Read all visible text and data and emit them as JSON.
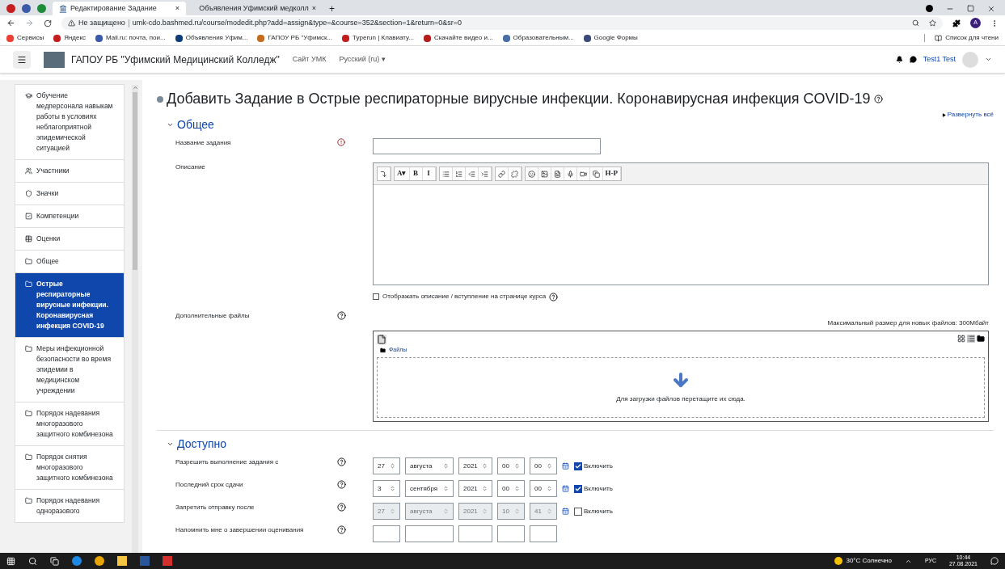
{
  "browser": {
    "tabs": [
      {
        "title": "Редактирование Задание",
        "selected": true,
        "close": "×"
      },
      {
        "title": "Объявления Уфимский медколл",
        "selected": false,
        "close": "×"
      }
    ],
    "new_tab": "+",
    "security": "Не защищено",
    "url": "umk-cdo.bashmed.ru/course/modedit.php?add=assign&type=&course=352&section=1&return=0&sr=0",
    "bookmarks": [
      "Сервисы",
      "Яндекс",
      "Mail.ru: почта, пои...",
      "Объявления Уфим...",
      "ГАПОУ РБ \"Уфимск...",
      "Typerun | Клавиату...",
      "Скачайте видео и...",
      "Образовательным...",
      "Google Формы"
    ],
    "reading_list": "Список для чтени",
    "profile": "A"
  },
  "header": {
    "site": "ГАПОУ РБ \"Уфимский Медицинский Колледж\"",
    "links": [
      "Сайт УМК",
      "Русский (ru) ▾"
    ],
    "user": "Test1 Test"
  },
  "sidebar": {
    "items": [
      {
        "kind": "cap",
        "label": "Обучение медперсонала навыкам работы в условиях неблагоприятной эпидемической ситуацией",
        "selected": false
      },
      {
        "kind": "users",
        "label": "Участники",
        "selected": false
      },
      {
        "kind": "shield",
        "label": "Значки",
        "selected": false
      },
      {
        "kind": "check",
        "label": "Компетенции",
        "selected": false
      },
      {
        "kind": "table",
        "label": "Оценки",
        "selected": false
      },
      {
        "kind": "folder",
        "label": "Общее",
        "selected": false
      },
      {
        "kind": "folder",
        "label": "Острые респираторные вирусные инфекции. Коронавирусная инфекция COVID-19",
        "selected": true
      },
      {
        "kind": "folder",
        "label": "Меры инфекционной безопасности во время эпидемии в медицинском учреждении",
        "selected": false
      },
      {
        "kind": "folder",
        "label": "Порядок надевания многоразового защитного комбинезона",
        "selected": false
      },
      {
        "kind": "folder",
        "label": "Порядок снятия многоразового защитного комбинезона",
        "selected": false
      },
      {
        "kind": "folder",
        "label": "Порядок надевания одноразового",
        "selected": false
      }
    ]
  },
  "page": {
    "title": "Добавить Задание в Острые респираторные вирусные инфекции. Коронавирусная инфекция COVID-19",
    "expand_all": "Развернуть всё",
    "general": {
      "heading": "Общее",
      "expanded": true,
      "name_label": "Название задания",
      "description_label": "Описание",
      "toolbar": [
        [
          {
            "kind": "icon"
          }
        ],
        [
          {
            "kind": "text",
            "label": "A▾"
          },
          {
            "kind": "text",
            "label": "B"
          },
          {
            "kind": "text",
            "label": "I"
          }
        ],
        [
          {
            "kind": "icon"
          },
          {
            "kind": "icon"
          },
          {
            "kind": "icon"
          },
          {
            "kind": "icon"
          }
        ],
        [
          {
            "kind": "icon"
          },
          {
            "kind": "icon"
          }
        ],
        [
          {
            "kind": "icon"
          },
          {
            "kind": "icon"
          },
          {
            "kind": "icon"
          },
          {
            "kind": "icon"
          },
          {
            "kind": "icon"
          },
          {
            "kind": "icon"
          },
          {
            "kind": "text",
            "label": "H-P"
          }
        ]
      ],
      "show_description": {
        "label": "Отображать описание / вступление на странице курса",
        "checked": false
      },
      "files_label": "Дополнительные файлы",
      "max_size": "Максимальный размер для новых файлов: 300Мбайт",
      "folder": "Файлы",
      "drop_hint": "Для загрузки файлов перетащите их сюда."
    },
    "availability": {
      "heading": "Доступно",
      "expanded": true,
      "rows": [
        {
          "kind": "date",
          "label": "Разрешить выполнение задания с",
          "fields": [
            "27",
            "августа",
            "2021",
            "00",
            "00"
          ],
          "enable": "Включить",
          "checked": true
        },
        {
          "kind": "date",
          "label": "Последний срок сдачи",
          "fields": [
            "3",
            "сентября",
            "2021",
            "00",
            "00"
          ],
          "enable": "Включить",
          "checked": true
        },
        {
          "kind": "date",
          "label": "Запретить отправку после",
          "fields": [
            "27",
            "августа",
            "2021",
            "10",
            "41"
          ],
          "enable": "Включить",
          "checked": false
        },
        {
          "kind": "cut",
          "label": "Напомнить мне о завершении оценивания"
        }
      ]
    }
  },
  "taskbar": {
    "weather": "30°C Солнечно",
    "lang": "РУС",
    "time": "10:44",
    "date": "27.08.2021"
  }
}
